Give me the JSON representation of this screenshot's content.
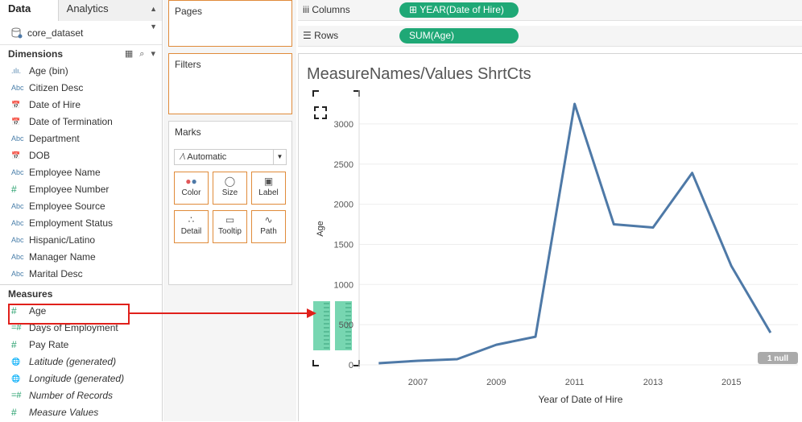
{
  "tabs": {
    "data": "Data",
    "analytics": "Analytics"
  },
  "datasource": "core_dataset",
  "dimensions": {
    "header": "Dimensions",
    "items": [
      {
        "icon": ".ılı.",
        "label": "Age (bin)"
      },
      {
        "icon": "Abc",
        "label": "Citizen Desc"
      },
      {
        "icon": "cal",
        "label": "Date of Hire"
      },
      {
        "icon": "cal",
        "label": "Date of Termination"
      },
      {
        "icon": "Abc",
        "label": "Department"
      },
      {
        "icon": "cal",
        "label": "DOB"
      },
      {
        "icon": "Abc",
        "label": "Employee Name"
      },
      {
        "icon": "#",
        "label": "Employee Number"
      },
      {
        "icon": "Abc",
        "label": "Employee Source"
      },
      {
        "icon": "Abc",
        "label": "Employment Status"
      },
      {
        "icon": "Abc",
        "label": "Hispanic/Latino"
      },
      {
        "icon": "Abc",
        "label": "Manager Name"
      },
      {
        "icon": "Abc",
        "label": "Marital Desc"
      }
    ]
  },
  "measures": {
    "header": "Measures",
    "items": [
      {
        "icon": "#",
        "label": "Age"
      },
      {
        "icon": "=#",
        "label": "Days of Employment"
      },
      {
        "icon": "#",
        "label": "Pay Rate"
      },
      {
        "icon": "globe",
        "label": "Latitude (generated)"
      },
      {
        "icon": "globe",
        "label": "Longitude (generated)"
      },
      {
        "icon": "=#",
        "label": "Number of Records"
      },
      {
        "icon": "#",
        "label": "Measure Values"
      }
    ]
  },
  "cards": {
    "pages": "Pages",
    "filters": "Filters",
    "marks": "Marks",
    "mark_type": "Automatic",
    "buttons": [
      "Color",
      "Size",
      "Label",
      "Detail",
      "Tooltip",
      "Path"
    ]
  },
  "shelves": {
    "columns_label": "Columns",
    "columns_pill": "YEAR(Date of Hire)",
    "rows_label": "Rows",
    "rows_pill": "SUM(Age)"
  },
  "sheet_title": "MeasureNames/Values ShrtCts",
  "null_badge": "1 null",
  "colors": {
    "line": "#4e79a7",
    "pill": "#1fa876",
    "annotation": "#e0201b"
  },
  "chart_data": {
    "type": "line",
    "x": [
      2006,
      2007,
      2008,
      2009,
      2010,
      2011,
      2012,
      2013,
      2014,
      2015,
      2016
    ],
    "values": [
      20,
      50,
      70,
      250,
      350,
      3250,
      1750,
      1710,
      2390,
      1230,
      400
    ],
    "xlabel": "Year of Date of Hire",
    "ylabel": "Age",
    "xticks": [
      2007,
      2009,
      2011,
      2013,
      2015
    ],
    "yticks": [
      0,
      500,
      1000,
      1500,
      2000,
      2500,
      3000
    ],
    "xlim": [
      2005.5,
      2016.7
    ],
    "ylim": [
      0,
      3300
    ]
  }
}
